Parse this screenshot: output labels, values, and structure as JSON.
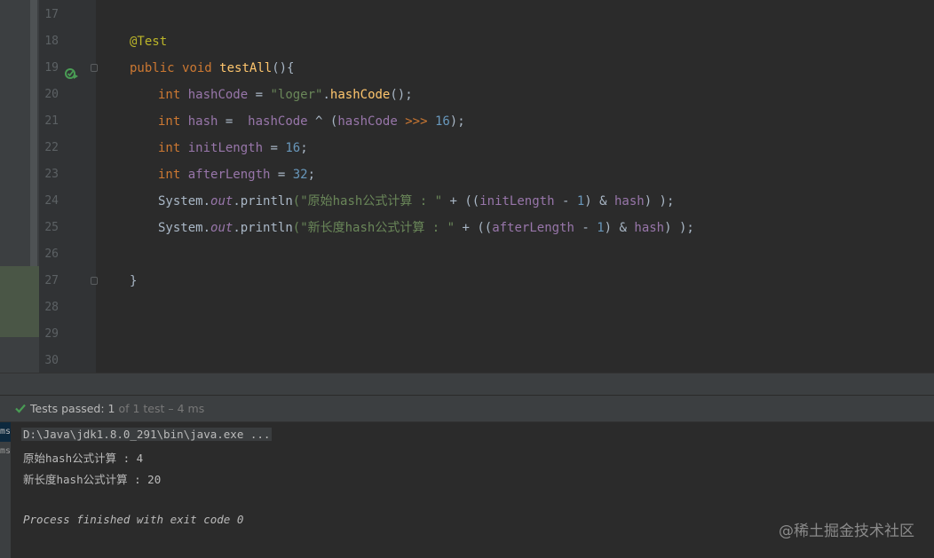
{
  "editor": {
    "line_numbers": [
      "17",
      "18",
      "19",
      "20",
      "21",
      "22",
      "23",
      "24",
      "25",
      "26",
      "27",
      "28",
      "29",
      "30"
    ],
    "tokens": {
      "annotation": "@Test",
      "kw_public": "public",
      "kw_void": "void",
      "method_name": "testAll",
      "method_open": "(){",
      "kw_int": "int",
      "var_hashCode": "hashCode",
      "var_hash": "hash",
      "var_initLength": "initLength",
      "var_afterLength": "afterLength",
      "eq": " = ",
      "eq_wide": " =  ",
      "str_loger": "\"loger\"",
      "dot_hashCode_call": ".",
      "method_hashCode": "hashCode",
      "call_end": "();",
      "xor": " ^ ",
      "paren_open": "(",
      "ushr": " >>> ",
      "num_16": "16",
      "num_32": "32",
      "num_1": "1",
      "close_semicolon": ");",
      "semicolon": ";",
      "system": "System",
      "dot": ".",
      "field_out": "out",
      "println": "println",
      "str_orig": "(\"原始hash公式计算 : \"",
      "str_new": "(\"新长度hash公式计算 : \"",
      "plus": " + ",
      "dbl_paren": "((",
      "minus": " - ",
      "close_amp": ") & ",
      "tail": ") );",
      "close_brace": "}"
    }
  },
  "test_status": {
    "label": "Tests passed: ",
    "count": "1",
    "rest": " of 1 test – 4 ms"
  },
  "console": {
    "side_tab_a": "ms",
    "side_tab_b": "ms",
    "command": "D:\\Java\\jdk1.8.0_291\\bin\\java.exe ...",
    "out1": "原始hash公式计算 : 4",
    "out2": "新长度hash公式计算 : 20",
    "exit": "Process finished with exit code 0"
  },
  "watermark": "@稀土掘金技术社区",
  "colors": {
    "keyword": "#cc7832",
    "annotation": "#bbb529",
    "method": "#ffc66d",
    "string": "#6a8759",
    "number": "#6897bb",
    "variable": "#9876aa",
    "text": "#a9b7c6",
    "pass_green": "#499c54"
  }
}
